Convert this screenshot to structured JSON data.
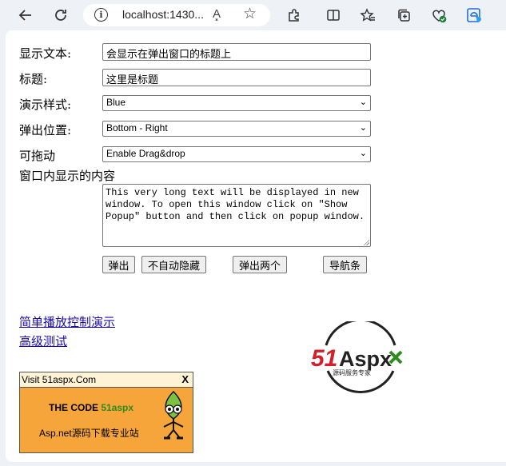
{
  "browser": {
    "url": "localhost:1430...",
    "read_aloud_label": "A͓",
    "icons": [
      "back-icon",
      "refresh-icon",
      "info-icon",
      "read-aloud-icon",
      "favorite-star-icon",
      "extensions-icon",
      "split-screen-icon",
      "favorites-icon",
      "collections-icon",
      "browser-essentials-icon",
      "edge-icon"
    ]
  },
  "form": {
    "display_text_label": "显示文本:",
    "display_text_value": "会显示在弹出窗口的标题上",
    "title_label": "标题:",
    "title_value": "这里是标题",
    "style_label": "演示样式:",
    "style_value": "Blue",
    "position_label": "弹出位置:",
    "position_value": "Bottom - Right",
    "drag_label": "可拖动",
    "drag_value": "Enable Drag&drop",
    "content_label": "窗口内显示的内容",
    "content_value": "This very long text will be displayed in new window. To open this window click on \"Show Popup\" button and then click on popup window."
  },
  "buttons": {
    "popup": "弹出",
    "no_autohide": "不自动隐藏",
    "popup_two": "弹出两个",
    "navbar": "导航条"
  },
  "links": {
    "simple_demo": "简单播放控制演示",
    "advanced_test": "高级测试"
  },
  "logo": {
    "brand_51": "51",
    "brand_aspx": "Aspx",
    "tagline": "源码服务专家"
  },
  "ad": {
    "title": "Visit 51aspx.Com",
    "close": "X",
    "line1_prefix": "THE CODE ",
    "line1_brand": "51aspx",
    "line2": "Asp.net源码下载专业站"
  },
  "colors": {
    "brand_red": "#d2202a",
    "brand_green": "#2e8b1e",
    "ad_background": "#f5a53a",
    "link": "#1a0dab"
  }
}
